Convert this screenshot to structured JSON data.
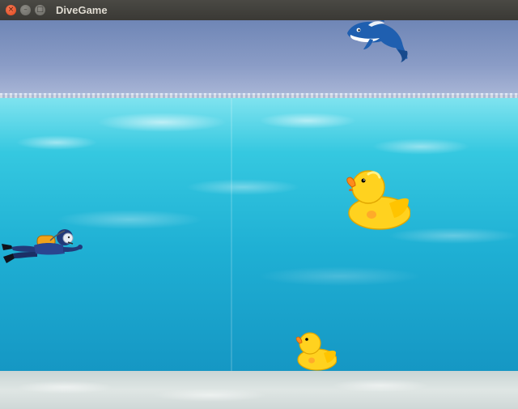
{
  "window": {
    "title": "DiveGame",
    "close_glyph": "×",
    "minimize_glyph": "–",
    "maximize_glyph": "□"
  },
  "scene": {
    "colors": {
      "sky": "#7f93c1",
      "water": "#2cbfe0",
      "seabed": "#d3ddd9",
      "duck": "#ffd21f",
      "whale": "#1f5fb0"
    },
    "sprites": [
      {
        "kind": "whale",
        "icon": "whale-icon"
      },
      {
        "kind": "large-rubber-duck",
        "icon": "rubber-duck-icon"
      },
      {
        "kind": "small-rubber-duck",
        "icon": "rubber-duck-icon"
      },
      {
        "kind": "scuba-diver",
        "icon": "scuba-diver-icon"
      }
    ]
  }
}
